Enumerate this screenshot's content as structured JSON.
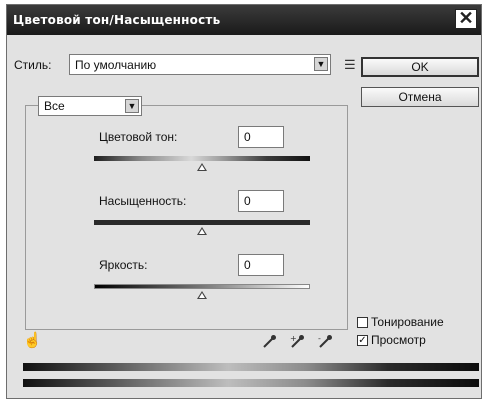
{
  "window": {
    "title": "Цветовой тон/Насыщенность",
    "close_glyph": "✕"
  },
  "style": {
    "label": "Стиль:",
    "value": "По умолчанию",
    "menu_icon": "options-menu-icon"
  },
  "buttons": {
    "ok": "OK",
    "cancel": "Отмена"
  },
  "channel": {
    "value": "Все"
  },
  "hue": {
    "label": "Цветовой тон:",
    "value": "0",
    "position": 0.5
  },
  "saturation": {
    "label": "Насыщенность:",
    "value": "0",
    "position": 0.5
  },
  "lightness": {
    "label": "Яркость:",
    "value": "0",
    "position": 0.5
  },
  "colorize": {
    "label": "Тонирование",
    "checked": false
  },
  "preview": {
    "label": "Просмотр",
    "checked": true,
    "mark": "✓"
  }
}
